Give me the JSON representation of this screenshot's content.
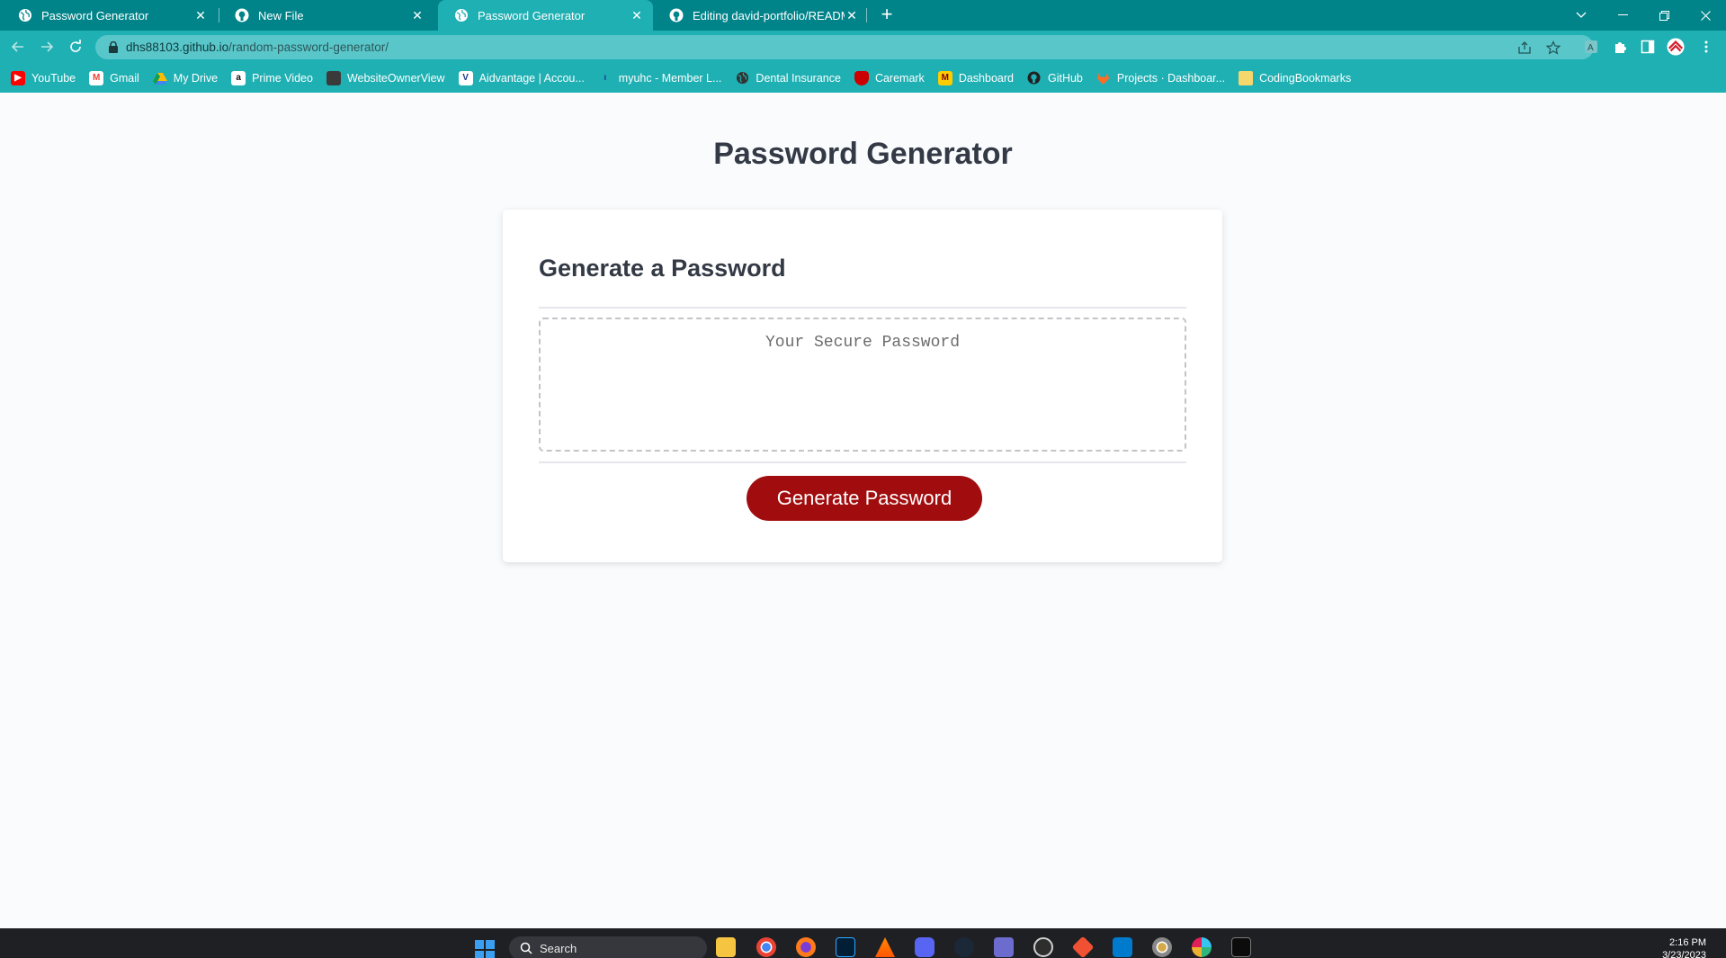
{
  "tabs": [
    {
      "title": "Password Generator",
      "icon": "globe-icon",
      "active": false
    },
    {
      "title": "New File",
      "icon": "github-icon",
      "active": false
    },
    {
      "title": "Password Generator",
      "icon": "globe-icon",
      "active": true
    },
    {
      "title": "Editing david-portfolio/README.md",
      "icon": "github-icon",
      "active": false
    }
  ],
  "omnibox": {
    "domain": "dhs88103.github.io",
    "path": "/random-password-generator/"
  },
  "bookmarks": [
    {
      "label": "YouTube",
      "icon": "youtube-icon",
      "color": "#ff0000"
    },
    {
      "label": "Gmail",
      "icon": "gmail-icon",
      "color": "#ea4335"
    },
    {
      "label": "My Drive",
      "icon": "drive-icon",
      "color": "#fbbc04"
    },
    {
      "label": "Prime Video",
      "icon": "amazon-icon",
      "color": "#ffffff"
    },
    {
      "label": "WebsiteOwnerView",
      "icon": "box-icon",
      "color": "#444444"
    },
    {
      "label": "Aidvantage | Accou...",
      "icon": "aidvantage-icon",
      "color": "#1a3c8c"
    },
    {
      "label": "myuhc - Member L...",
      "icon": "uhc-icon",
      "color": "#1a3c8c"
    },
    {
      "label": "Dental Insurance",
      "icon": "globe-icon",
      "color": "#333333"
    },
    {
      "label": "Caremark",
      "icon": "caremark-icon",
      "color": "#cc0000"
    },
    {
      "label": "Dashboard",
      "icon": "dashboard-icon",
      "color": "#ffcc00"
    },
    {
      "label": "GitHub",
      "icon": "github-icon",
      "color": "#222222"
    },
    {
      "label": "Projects · Dashboar...",
      "icon": "gitlab-icon",
      "color": "#fc6d26"
    },
    {
      "label": "CodingBookmarks",
      "icon": "folder-icon",
      "color": "#f5d76e"
    }
  ],
  "page": {
    "title": "Password Generator",
    "card_title": "Generate a Password",
    "password_placeholder": "Your Secure Password",
    "button_label": "Generate Password"
  },
  "taskbar": {
    "search_label": "Search",
    "time": "2:16 PM",
    "date": "3/23/2023",
    "apps": [
      "file-explorer-icon",
      "chrome-icon",
      "firefox-icon",
      "photoshop-icon",
      "vlc-icon",
      "discord-icon",
      "steam-icon",
      "visual-studio-icon",
      "obs-icon",
      "git-icon",
      "vscode-icon",
      "chrome-dev-icon",
      "slack-icon",
      "terminal-icon"
    ]
  },
  "colors": {
    "tabstrip": "#00848a",
    "toolbar": "#1fb0b3",
    "button": "#a10d0e",
    "title_text": "#333a45",
    "page_bg": "#f9fbfd"
  }
}
